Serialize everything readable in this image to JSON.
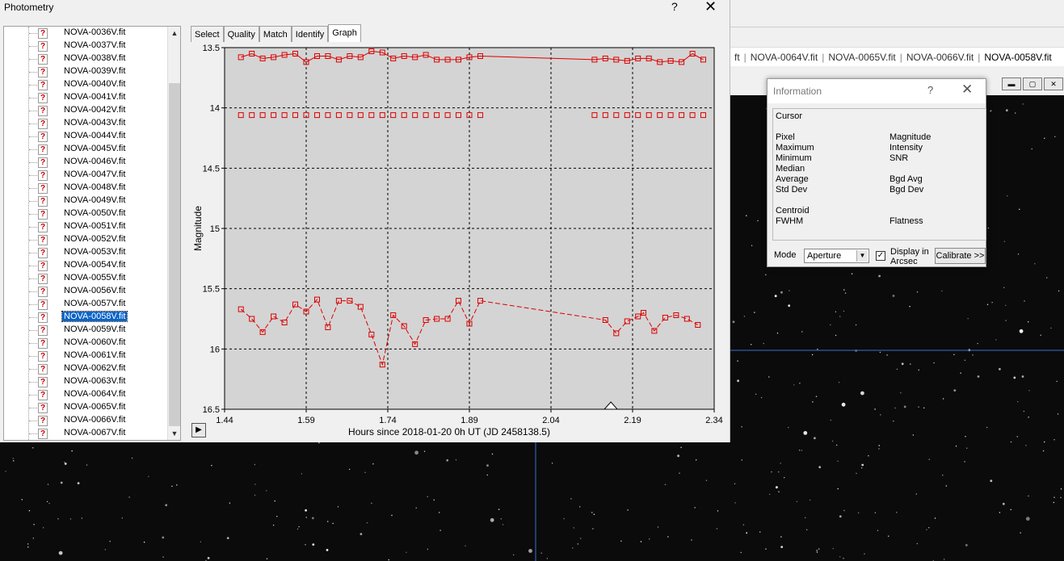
{
  "photometry_window": {
    "title": "Photometry",
    "help_icon": "?",
    "close_icon": "✕",
    "files": [
      "NOVA-0036V.fit",
      "NOVA-0037V.fit",
      "NOVA-0038V.fit",
      "NOVA-0039V.fit",
      "NOVA-0040V.fit",
      "NOVA-0041V.fit",
      "NOVA-0042V.fit",
      "NOVA-0043V.fit",
      "NOVA-0044V.fit",
      "NOVA-0045V.fit",
      "NOVA-0046V.fit",
      "NOVA-0047V.fit",
      "NOVA-0048V.fit",
      "NOVA-0049V.fit",
      "NOVA-0050V.fit",
      "NOVA-0051V.fit",
      "NOVA-0052V.fit",
      "NOVA-0053V.fit",
      "NOVA-0054V.fit",
      "NOVA-0055V.fit",
      "NOVA-0056V.fit",
      "NOVA-0057V.fit",
      "NOVA-0058V.fit",
      "NOVA-0059V.fit",
      "NOVA-0060V.fit",
      "NOVA-0061V.fit",
      "NOVA-0062V.fit",
      "NOVA-0063V.fit",
      "NOVA-0064V.fit",
      "NOVA-0065V.fit",
      "NOVA-0066V.fit",
      "NOVA-0067V.fit"
    ],
    "selected_file": "NOVA-0058V.fit",
    "file_icon_glyph": "?",
    "tabs": [
      "Select",
      "Quality",
      "Match",
      "Identify",
      "Graph"
    ],
    "active_tab": "Graph",
    "play_glyph": "▶"
  },
  "chart_data": {
    "type": "line",
    "xlabel": "Hours since 2018-01-20 0h UT (JD 2458138.5)",
    "ylabel": "Magnitude",
    "xlim": [
      1.44,
      2.34
    ],
    "ylim": [
      13.5,
      16.5
    ],
    "y_inverted": true,
    "xticks": [
      "1.44",
      "1.59",
      "1.74",
      "1.89",
      "2.04",
      "2.19",
      "2.34"
    ],
    "yticks": [
      "13.5",
      "14",
      "14.5",
      "15",
      "15.5",
      "16",
      "16.5"
    ],
    "grid": true,
    "marker_x": 2.15,
    "series": [
      {
        "color": "#dd0000",
        "line": "solid",
        "x": [
          1.47,
          1.49,
          1.51,
          1.53,
          1.55,
          1.57,
          1.59,
          1.61,
          1.63,
          1.65,
          1.67,
          1.69,
          1.71,
          1.73,
          1.75,
          1.77,
          1.79,
          1.81,
          1.83,
          1.85,
          1.87,
          1.89,
          1.91,
          2.12,
          2.14,
          2.16,
          2.18,
          2.2,
          2.22,
          2.24,
          2.26,
          2.28,
          2.3,
          2.32
        ],
        "y": [
          13.58,
          13.55,
          13.59,
          13.58,
          13.56,
          13.55,
          13.62,
          13.57,
          13.57,
          13.6,
          13.57,
          13.58,
          13.53,
          13.54,
          13.59,
          13.57,
          13.58,
          13.56,
          13.6,
          13.6,
          13.6,
          13.58,
          13.57,
          13.6,
          13.59,
          13.6,
          13.61,
          13.59,
          13.59,
          13.62,
          13.61,
          13.62,
          13.55,
          13.6
        ]
      },
      {
        "color": "#dd0000",
        "line": "none",
        "x": [
          1.47,
          1.49,
          1.51,
          1.53,
          1.55,
          1.57,
          1.59,
          1.61,
          1.63,
          1.65,
          1.67,
          1.69,
          1.71,
          1.73,
          1.75,
          1.77,
          1.79,
          1.81,
          1.83,
          1.85,
          1.87,
          1.89,
          1.91,
          2.12,
          2.14,
          2.16,
          2.18,
          2.2,
          2.22,
          2.24,
          2.26,
          2.28,
          2.3,
          2.32
        ],
        "y": [
          14.06,
          14.06,
          14.06,
          14.06,
          14.06,
          14.06,
          14.06,
          14.06,
          14.06,
          14.06,
          14.06,
          14.06,
          14.06,
          14.06,
          14.06,
          14.06,
          14.06,
          14.06,
          14.06,
          14.06,
          14.06,
          14.06,
          14.06,
          14.06,
          14.06,
          14.06,
          14.06,
          14.06,
          14.06,
          14.06,
          14.06,
          14.06,
          14.06,
          14.06
        ]
      },
      {
        "color": "#dd0000",
        "line": "dashed",
        "x": [
          1.47,
          1.49,
          1.51,
          1.53,
          1.55,
          1.57,
          1.59,
          1.61,
          1.63,
          1.65,
          1.67,
          1.69,
          1.71,
          1.73,
          1.75,
          1.77,
          1.79,
          1.81,
          1.83,
          1.85,
          1.87,
          1.89,
          1.91,
          2.14,
          2.16,
          2.18,
          2.2,
          2.21,
          2.23,
          2.25,
          2.27,
          2.29,
          2.31
        ],
        "y": [
          15.67,
          15.75,
          15.86,
          15.73,
          15.78,
          15.63,
          15.69,
          15.59,
          15.82,
          15.6,
          15.6,
          15.65,
          15.88,
          16.13,
          15.72,
          15.81,
          15.96,
          15.76,
          15.75,
          15.75,
          15.6,
          15.79,
          15.6,
          15.76,
          15.87,
          15.77,
          15.73,
          15.7,
          15.85,
          15.74,
          15.72,
          15.75,
          15.8
        ]
      }
    ]
  },
  "information_window": {
    "title": "Information",
    "help_icon": "?",
    "close_icon": "✕",
    "cursor_label": "Cursor",
    "left_labels": [
      "Pixel",
      "Maximum",
      "Minimum",
      "Median",
      "Average",
      "Std Dev"
    ],
    "right_labels": [
      "Magnitude",
      "Intensity",
      "SNR",
      "Bgd Avg",
      "Bgd Dev"
    ],
    "centroid_label": "Centroid",
    "fwhm_label": "FWHM",
    "flatness_label": "Flatness",
    "mode_label": "Mode",
    "mode_value": "Aperture",
    "display_checkbox_label_1": "Display in",
    "display_checkbox_label_2": "Arcsec",
    "display_checked": true,
    "calibrate_label": "Calibrate >>"
  },
  "background_app": {
    "tabs": [
      "ft",
      "NOVA-0064V.fit",
      "NOVA-0065V.fit",
      "NOVA-0066V.fit",
      "NOVA-0058V.fit"
    ],
    "active_tab": "NOVA-0058V.fit"
  }
}
